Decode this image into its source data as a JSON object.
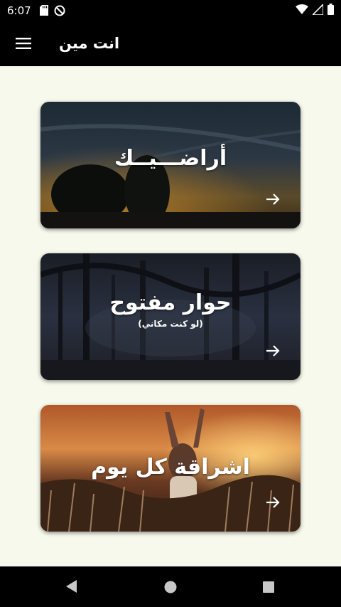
{
  "status_bar": {
    "time": "6:07",
    "icons_left": [
      "sd-card-icon",
      "do-not-disturb-icon"
    ],
    "icons_right": [
      "wifi-icon",
      "signal-icon",
      "battery-icon"
    ]
  },
  "app_bar": {
    "title": "انت مين",
    "menu_icon": "hamburger-menu-icon"
  },
  "cards": [
    {
      "title": "أراضـــيــك",
      "subtitle": "",
      "arrow_icon": "arrow-right-icon"
    },
    {
      "title": "حوار مفتوح",
      "subtitle": "(لو كنت مكاني)",
      "arrow_icon": "arrow-right-icon"
    },
    {
      "title": "اشراقة كل يوم",
      "subtitle": "",
      "arrow_icon": "arrow-right-icon"
    }
  ],
  "nav_bar": {
    "back_icon": "back-triangle-icon",
    "home_icon": "home-circle-icon",
    "recents_icon": "recents-square-icon"
  },
  "colors": {
    "background": "#f7f9ec",
    "bar": "#000000",
    "text_on_card": "#ffffff"
  }
}
